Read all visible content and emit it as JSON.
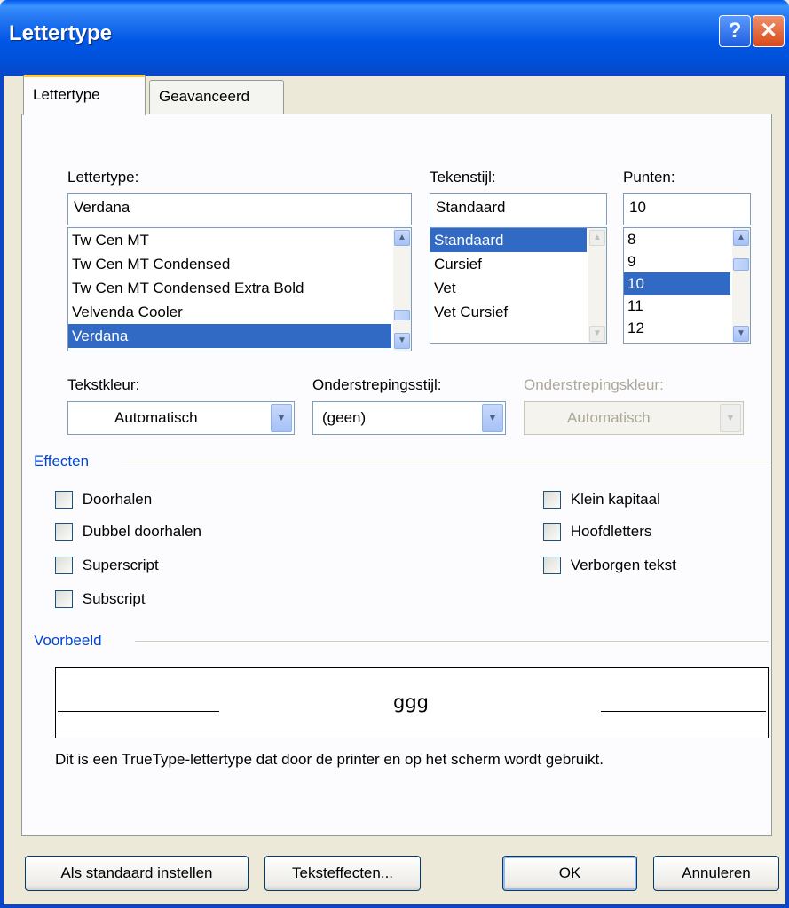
{
  "window": {
    "title": "Lettertype",
    "help_glyph": "?",
    "close_glyph": "✕"
  },
  "tabs": [
    {
      "label": "Lettertype"
    },
    {
      "label": "Geavanceerd"
    }
  ],
  "font": {
    "label": "Lettertype:",
    "value": "Verdana",
    "items": [
      "Tw Cen MT",
      "Tw Cen MT Condensed",
      "Tw Cen MT Condensed Extra Bold",
      "Velvenda Cooler",
      "Verdana"
    ],
    "selected": "Verdana"
  },
  "style": {
    "label": "Tekenstijl:",
    "value": "Standaard",
    "items": [
      "Standaard",
      "Cursief",
      "Vet",
      "Vet Cursief"
    ],
    "selected": "Standaard"
  },
  "size": {
    "label": "Punten:",
    "value": "10",
    "items": [
      "8",
      "9",
      "10",
      "11",
      "12"
    ],
    "selected": "10"
  },
  "color": {
    "label": "Tekstkleur:",
    "value": "Automatisch"
  },
  "underline_style": {
    "label": "Onderstrepingsstijl:",
    "value": "(geen)"
  },
  "underline_color": {
    "label": "Onderstrepingskleur:",
    "value": "Automatisch"
  },
  "effects": {
    "heading": "Effecten",
    "left": [
      "Doorhalen",
      "Dubbel doorhalen",
      "Superscript",
      "Subscript"
    ],
    "right": [
      "Klein kapitaal",
      "Hoofdletters",
      "Verborgen tekst"
    ]
  },
  "preview": {
    "heading": "Voorbeeld",
    "sample": "ggg",
    "note": "Dit is een TrueType-lettertype dat door de printer en op het scherm wordt gebruikt."
  },
  "buttons": {
    "default": "Als standaard instellen",
    "effects": "Teksteffecten...",
    "ok": "OK",
    "cancel": "Annuleren"
  },
  "colors": {
    "accent": "#0046d5",
    "selection": "#316ac5",
    "titlebar": "#0058ee"
  }
}
